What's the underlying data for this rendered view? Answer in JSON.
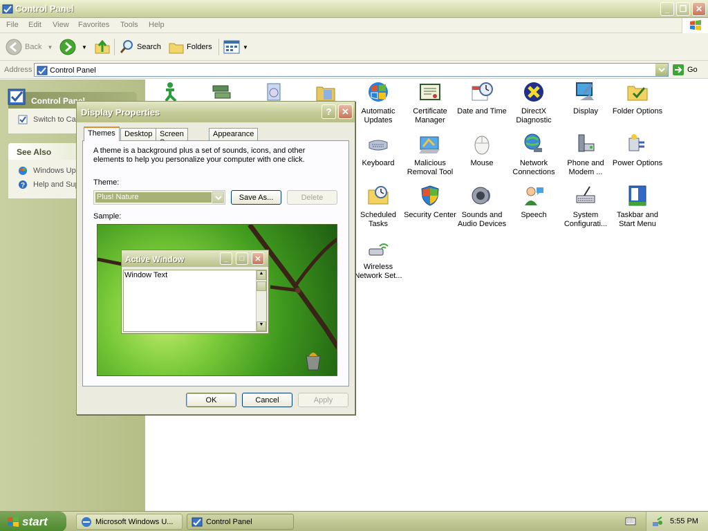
{
  "window": {
    "title": "Control Panel",
    "menu": [
      "File",
      "Edit",
      "View",
      "Favorites",
      "Tools",
      "Help"
    ]
  },
  "toolbar": {
    "back_label": "Back",
    "search_label": "Search",
    "folders_label": "Folders"
  },
  "address": {
    "label": "Address",
    "value": "Control Panel",
    "go_label": "Go"
  },
  "left_pane": {
    "control_panel": {
      "title": "Control Panel",
      "switch_label": "Switch to Cat"
    },
    "see_also": {
      "title": "See Also",
      "items": [
        "Windows Upd",
        "Help and Sup"
      ]
    }
  },
  "control_panel_items": [
    {
      "label": "Automatic Updates",
      "icon": "automatic-updates-icon"
    },
    {
      "label": "Certificate Manager",
      "icon": "certificate-manager-icon"
    },
    {
      "label": "Date and Time",
      "icon": "date-time-icon"
    },
    {
      "label": "DirectX Diagnostic",
      "icon": "directx-icon"
    },
    {
      "label": "Display",
      "icon": "display-icon"
    },
    {
      "label": "Folder Options",
      "icon": "folder-options-icon"
    },
    {
      "label": "Keyboard",
      "icon": "keyboard-icon"
    },
    {
      "label": "Malicious Removal Tool",
      "icon": "malicious-removal-icon"
    },
    {
      "label": "Mouse",
      "icon": "mouse-icon"
    },
    {
      "label": "Network Connections",
      "icon": "network-connections-icon"
    },
    {
      "label": "Phone and Modem ...",
      "icon": "phone-modem-icon"
    },
    {
      "label": "Power Options",
      "icon": "power-options-icon"
    },
    {
      "label": "Scheduled Tasks",
      "icon": "scheduled-tasks-icon"
    },
    {
      "label": "Security Center",
      "icon": "security-center-icon"
    },
    {
      "label": "Sounds and Audio Devices",
      "icon": "sounds-audio-icon"
    },
    {
      "label": "Speech",
      "icon": "speech-icon"
    },
    {
      "label": "System Configurati...",
      "icon": "system-config-icon"
    },
    {
      "label": "Taskbar and Start Menu",
      "icon": "taskbar-start-icon"
    },
    {
      "label": "Wireless Network Set...",
      "icon": "wireless-network-icon"
    }
  ],
  "dialog": {
    "title": "Display Properties",
    "tabs": [
      "Themes",
      "Desktop",
      "Screen Saver",
      "Appearance"
    ],
    "active_tab": "Themes",
    "description": "A theme is a background plus a set of sounds, icons, and other elements to help you personalize your computer with one click.",
    "theme_label": "Theme:",
    "theme_value": "Plus! Nature",
    "save_as_label": "Save As...",
    "delete_label": "Delete",
    "sample_label": "Sample:",
    "sample": {
      "active_window_title": "Active Window",
      "window_text": "Window Text"
    },
    "ok_label": "OK",
    "cancel_label": "Cancel",
    "apply_label": "Apply"
  },
  "taskbar": {
    "start_label": "start",
    "tasks": [
      "Microsoft Windows U...",
      "Control Panel"
    ],
    "clock": "5:55 PM"
  }
}
